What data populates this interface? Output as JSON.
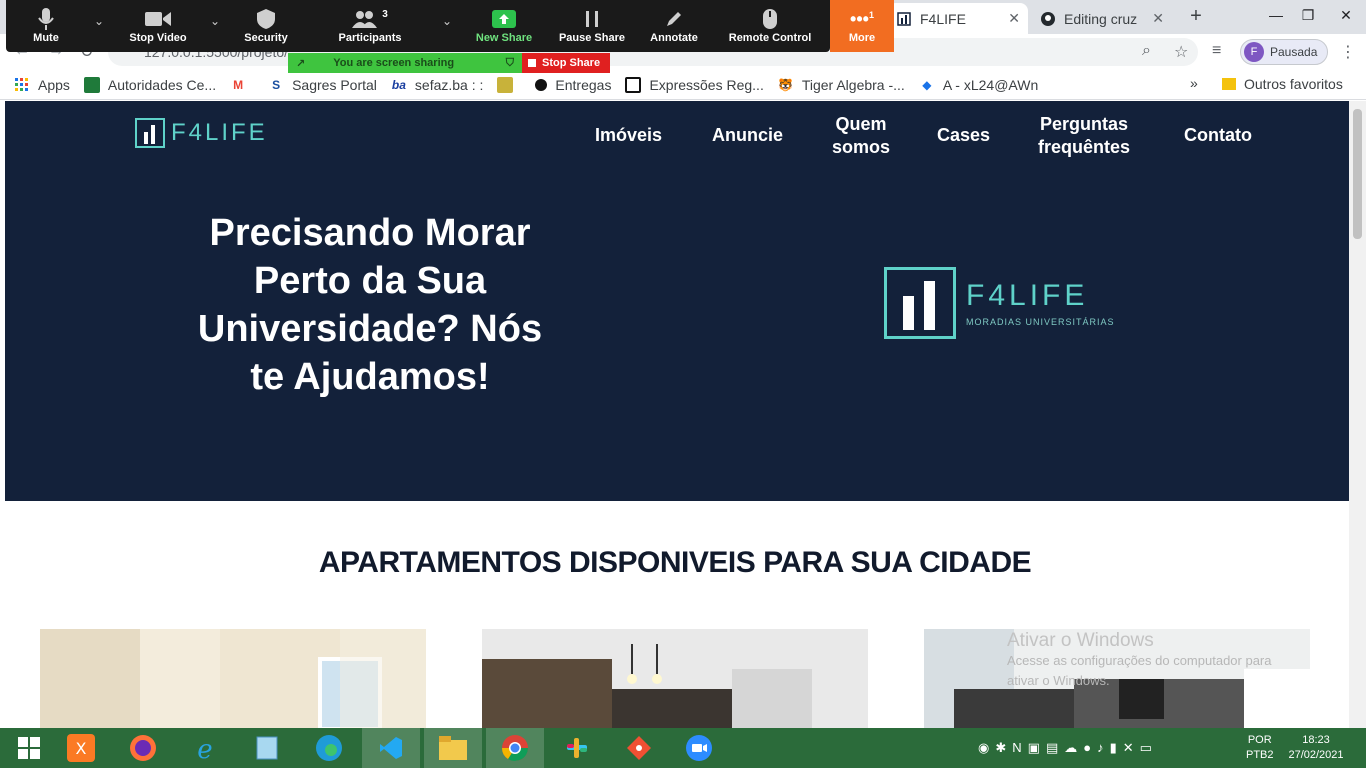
{
  "browser": {
    "tabs": [
      {
        "title": "F4LIFE",
        "active": true
      },
      {
        "title": "Editing cruz",
        "active": false
      }
    ],
    "url": "127.0.0.1:5500/projeto/",
    "profile": {
      "initial": "F",
      "label": "Pausada"
    }
  },
  "bookmarks": [
    {
      "label": "Apps",
      "icon": "apps-grid-icon"
    },
    {
      "label": "Autoridades Ce...",
      "icon": "flag-icon"
    },
    {
      "label": "",
      "icon": "gmail-icon"
    },
    {
      "label": "Sagres Portal",
      "icon": "sagres-icon"
    },
    {
      "label": "sefaz.ba : :",
      "icon": "sefaz-icon"
    },
    {
      "label": "",
      "icon": "contact-card-icon"
    },
    {
      "label": "Entregas",
      "icon": "circle-icon"
    },
    {
      "label": "Expressões Reg...",
      "icon": "regex-icon"
    },
    {
      "label": "Tiger Algebra -...",
      "icon": "tiger-icon"
    },
    {
      "label": "A - xL24@AWn",
      "icon": "cube-icon"
    }
  ],
  "bookmarks_more": "»",
  "bookmarks_other": "Outros favoritos",
  "zoom": {
    "buttons": [
      {
        "label": "Mute",
        "icon": "microphone-icon"
      },
      {
        "label": "Stop Video",
        "icon": "video-camera-icon"
      },
      {
        "label": "Security",
        "icon": "shield-icon"
      },
      {
        "label": "Participants",
        "icon": "participants-icon",
        "count": "3"
      },
      {
        "label": "New Share",
        "icon": "new-share-icon"
      },
      {
        "label": "Pause Share",
        "icon": "pause-icon"
      },
      {
        "label": "Annotate",
        "icon": "pencil-icon"
      },
      {
        "label": "Remote Control",
        "icon": "mouse-icon"
      }
    ],
    "more_label": "More",
    "more_badge": "1",
    "sharing_text": "You are screen sharing",
    "stop_share": "Stop Share"
  },
  "site": {
    "logo": "F4LIFE",
    "nav": [
      {
        "label": "Imóveis"
      },
      {
        "label": "Anuncie"
      },
      {
        "label": "Quem\nsomos"
      },
      {
        "label": "Cases"
      },
      {
        "label": "Perguntas\nfrequêntes"
      },
      {
        "label": "Contato"
      }
    ],
    "headline": "Precisando Morar Perto da Sua Universidade? Nós te Ajudamos!",
    "big_logo_name": "F4LIFE",
    "big_logo_sub": "MORADIAS UNIVERSITÁRIAS",
    "section_title": "APARTAMENTOS DISPONIVEIS PARA SUA CIDADE",
    "colors": {
      "hero_bg": "#13213a",
      "accent": "#5fd2c9"
    }
  },
  "watermark": {
    "line1": "Ativar o Windows",
    "line2": "Acesse as configurações do computador para",
    "line3": "ativar o Windows."
  },
  "taskbar": {
    "apps": [
      "windows-start-icon",
      "xampp-icon",
      "firefox-icon",
      "internet-explorer-icon",
      "notepad-icon",
      "edge-icon",
      "vscode-icon",
      "file-explorer-icon",
      "chrome-icon",
      "slack-icon",
      "git-icon",
      "zoom-icon"
    ],
    "lang1": "POR",
    "lang2": "PTB2",
    "time": "18:23",
    "date": "27/02/2021"
  }
}
